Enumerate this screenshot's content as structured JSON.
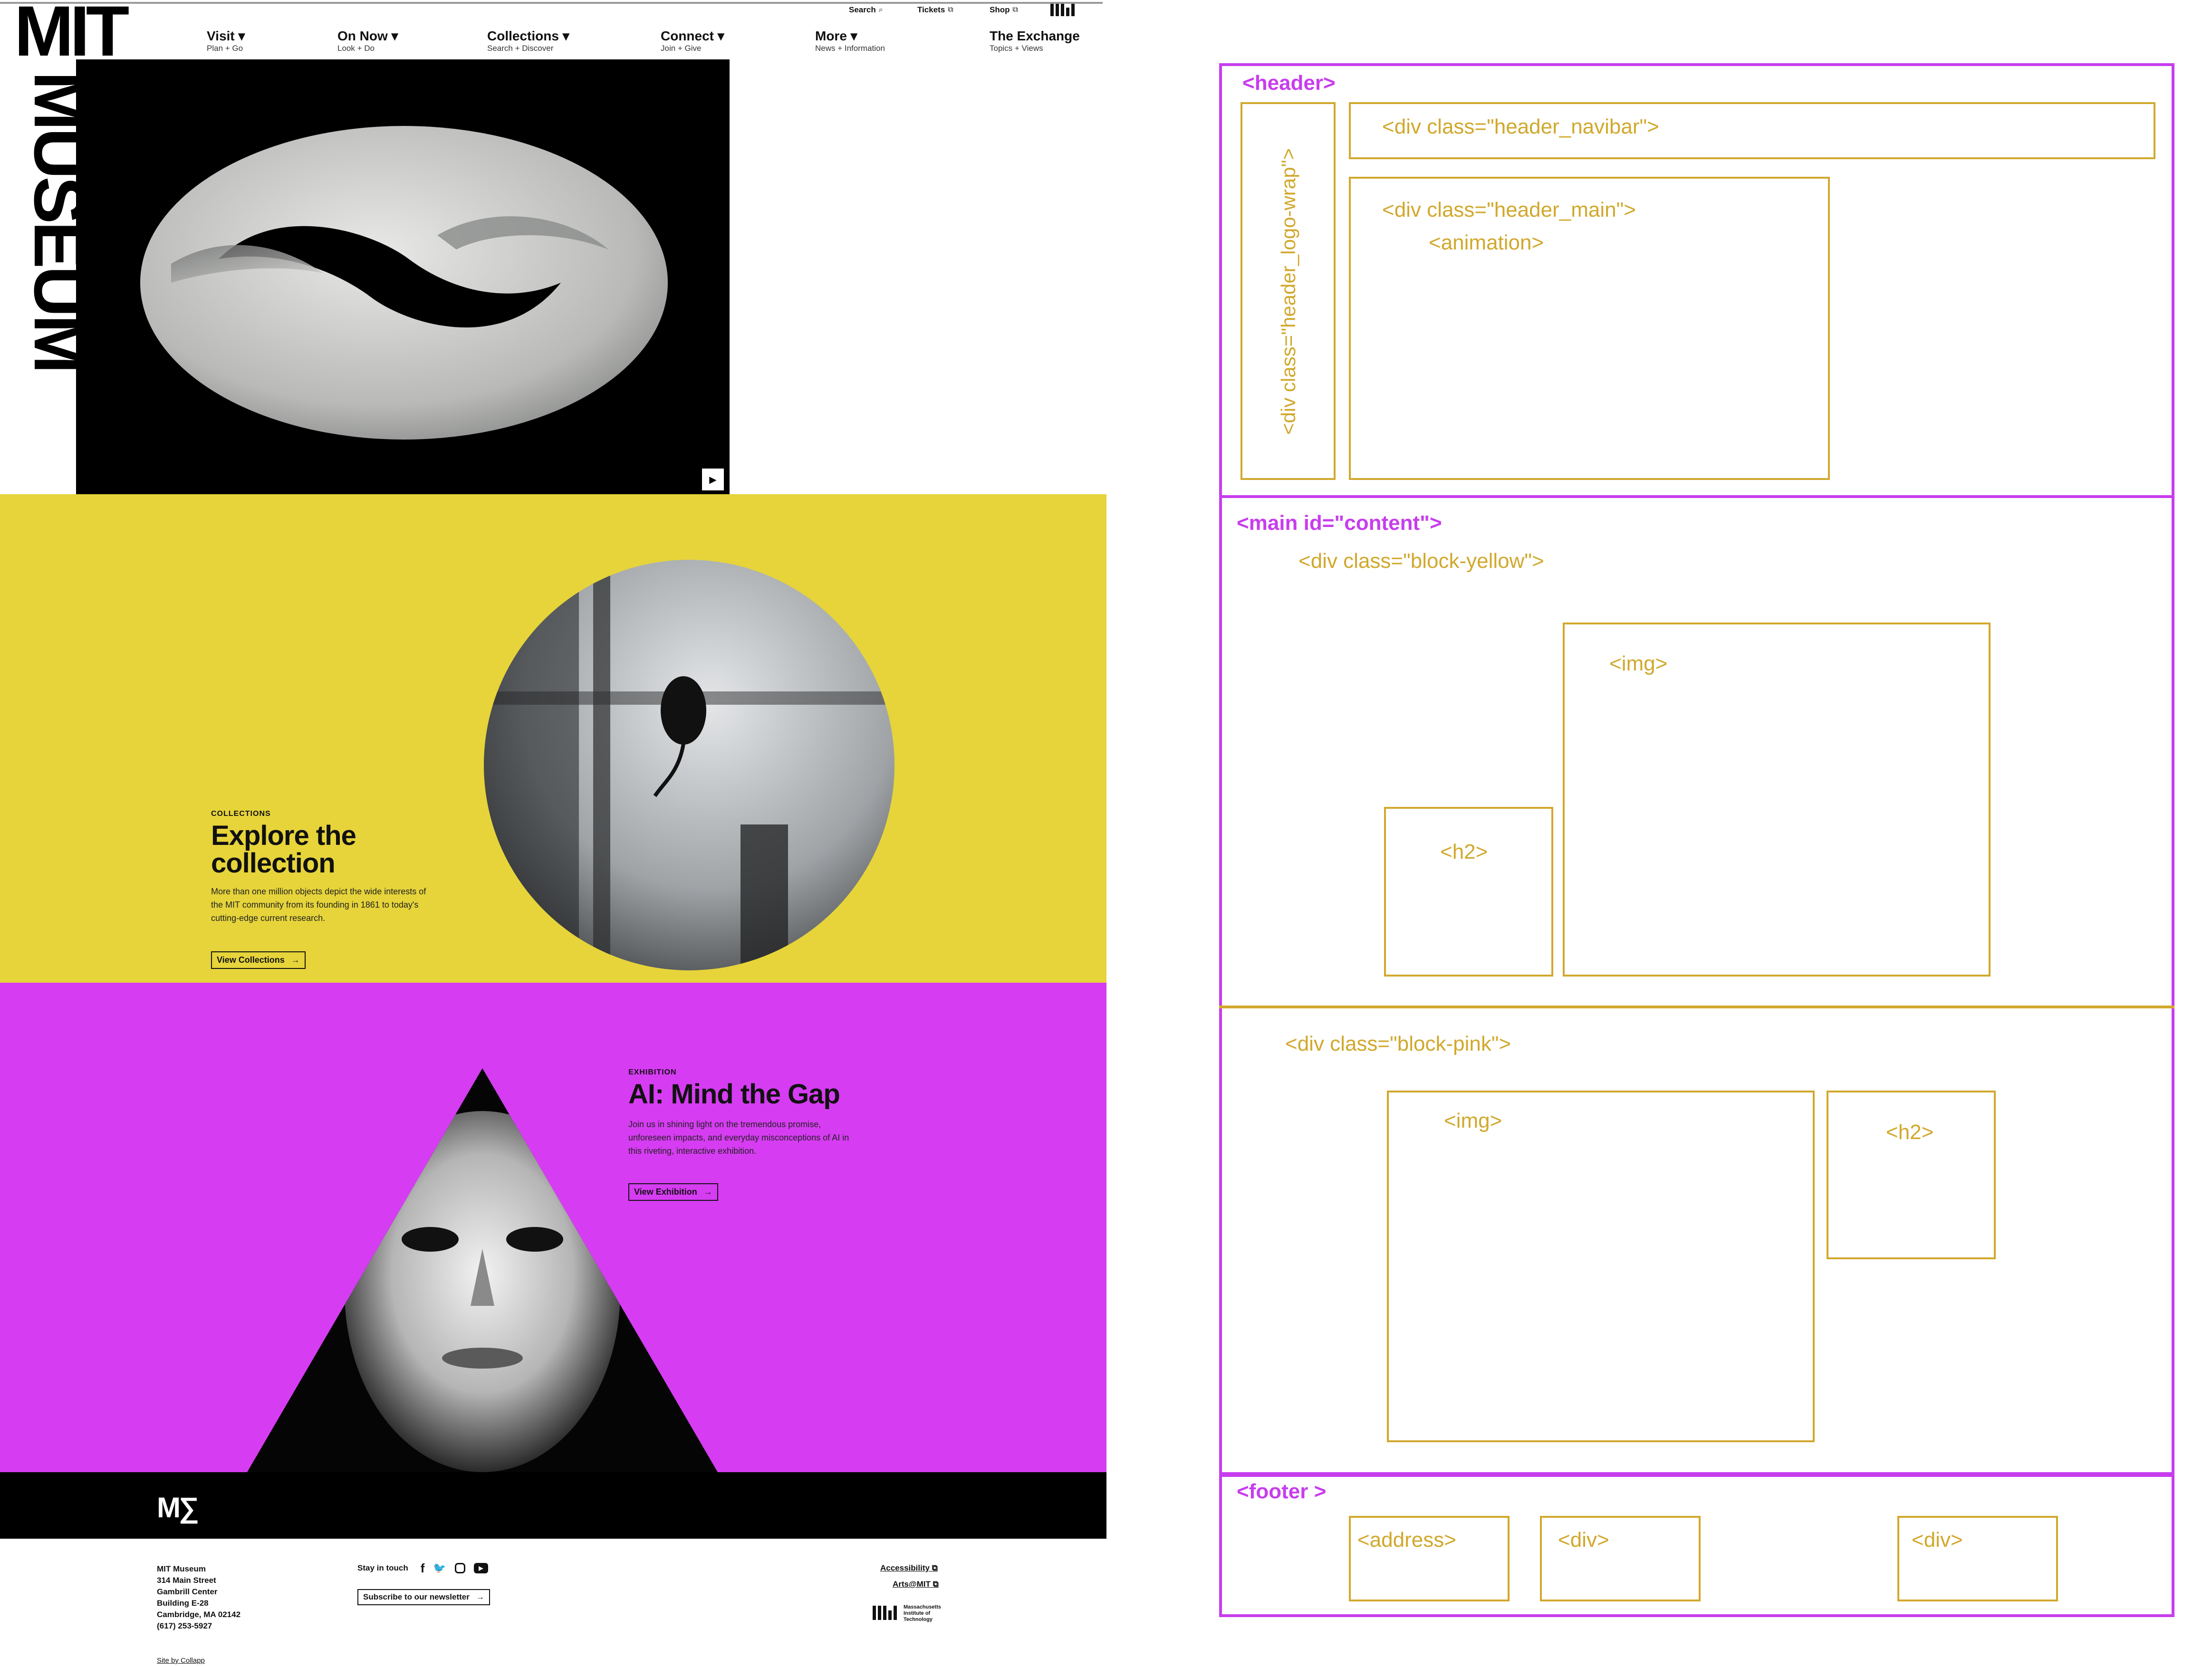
{
  "site": {
    "logo_line1": "MIT",
    "logo_line2": "MUSEUM",
    "utility": {
      "search_label": "Search",
      "tickets_label": "Tickets",
      "shop_label": "Shop"
    },
    "nav": [
      {
        "label": "Visit ▾",
        "sub": "Plan + Go"
      },
      {
        "label": "On Now ▾",
        "sub": "Look + Do"
      },
      {
        "label": "Collections ▾",
        "sub": "Search + Discover"
      },
      {
        "label": "Connect ▾",
        "sub": "Join + Give"
      },
      {
        "label": "More ▾",
        "sub": "News + Information"
      },
      {
        "label": "The Exchange",
        "sub": "Topics + Views"
      }
    ],
    "hero": {
      "play_icon": "play-icon"
    },
    "collections_block": {
      "eyebrow": "COLLECTIONS",
      "title_line1": "Explore the",
      "title_line2": "collection",
      "body_line1": "More than one million objects depict the wide interests of",
      "body_line2": "the MIT community from its founding in 1861 to today's",
      "body_line3": "cutting-edge current research.",
      "cta": "View Collections"
    },
    "exhibition_block": {
      "eyebrow": "EXHIBITION",
      "title": "AI: Mind the Gap",
      "body_line1": "Join us in shining light on the tremendous promise,",
      "body_line2": "unforeseen impacts, and everyday misconceptions of AI in",
      "body_line3": "this riveting, interactive exhibition.",
      "cta": "View Exhibition"
    },
    "footer": {
      "address": [
        "MIT Museum",
        "314 Main Street",
        "Gambrill Center",
        "Building E-28",
        "Cambridge, MA 02142",
        "(617) 253-5927"
      ],
      "stay_in_touch": "Stay in touch",
      "newsletter_cta": "Subscribe to our newsletter",
      "accessibility": "Accessibility",
      "arts": "Arts@MIT",
      "mit_name": [
        "Massachusetts",
        "Institute of",
        "Technology"
      ],
      "credit": "Site by Collapp"
    },
    "colors": {
      "yellow": "#e6d43a",
      "pink": "#d63cf2",
      "black": "#000000"
    }
  },
  "wireframe": {
    "header": "<header>",
    "logo_wrap": "<div class=\"header_logo-wrap\">",
    "navbar": "<div class=\"header_navibar\">",
    "main_div": "<div class=\"header_main\">",
    "animation": "<animation>",
    "main": "<main id=\"content\">",
    "block_yellow": "<div class=\"block-yellow\">",
    "img": "<img>",
    "h2": "<h2>",
    "block_pink": "<div class=\"block-pink\">",
    "footer": "<footer >",
    "address": "<address>",
    "div": "<div>",
    "colors": {
      "purple": "#c73ded",
      "gold": "#d1a82c"
    }
  }
}
